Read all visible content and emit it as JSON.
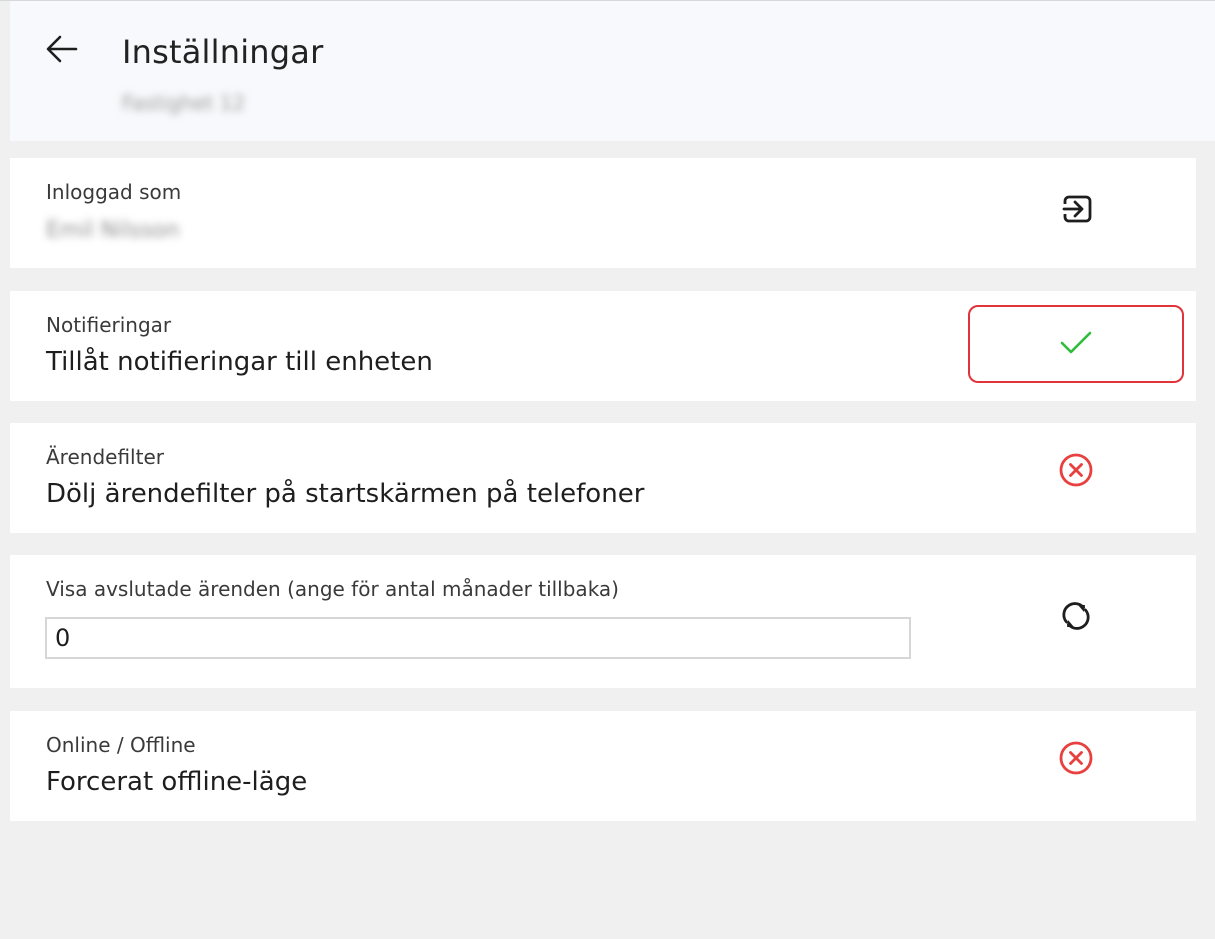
{
  "header": {
    "title": "Inställningar",
    "subtitle": "Fastighet 12"
  },
  "settings": {
    "logged_in": {
      "label": "Inloggad som",
      "value": "Emil Nilsson",
      "action_icon": "logout-icon"
    },
    "notifications": {
      "label": "Notifieringar",
      "value": "Tillåt notifieringar till enheten",
      "action_icon": "check-icon",
      "state": "on",
      "color": "#2ebd3a"
    },
    "case_filter": {
      "label": "Ärendefilter",
      "value": "Dölj ärendefilter på startskärmen på telefoner",
      "action_icon": "close-circle-icon",
      "state": "off",
      "color": "#e8403f"
    },
    "closed_cases": {
      "label": "Visa avslutade ärenden (ange för antal månader tillbaka)",
      "input_value": "0",
      "action_icon": "refresh-icon"
    },
    "online_offline": {
      "label": "Online / Offline",
      "value": "Forcerat offline-läge",
      "action_icon": "close-circle-icon",
      "state": "off",
      "color": "#e8403f"
    }
  }
}
